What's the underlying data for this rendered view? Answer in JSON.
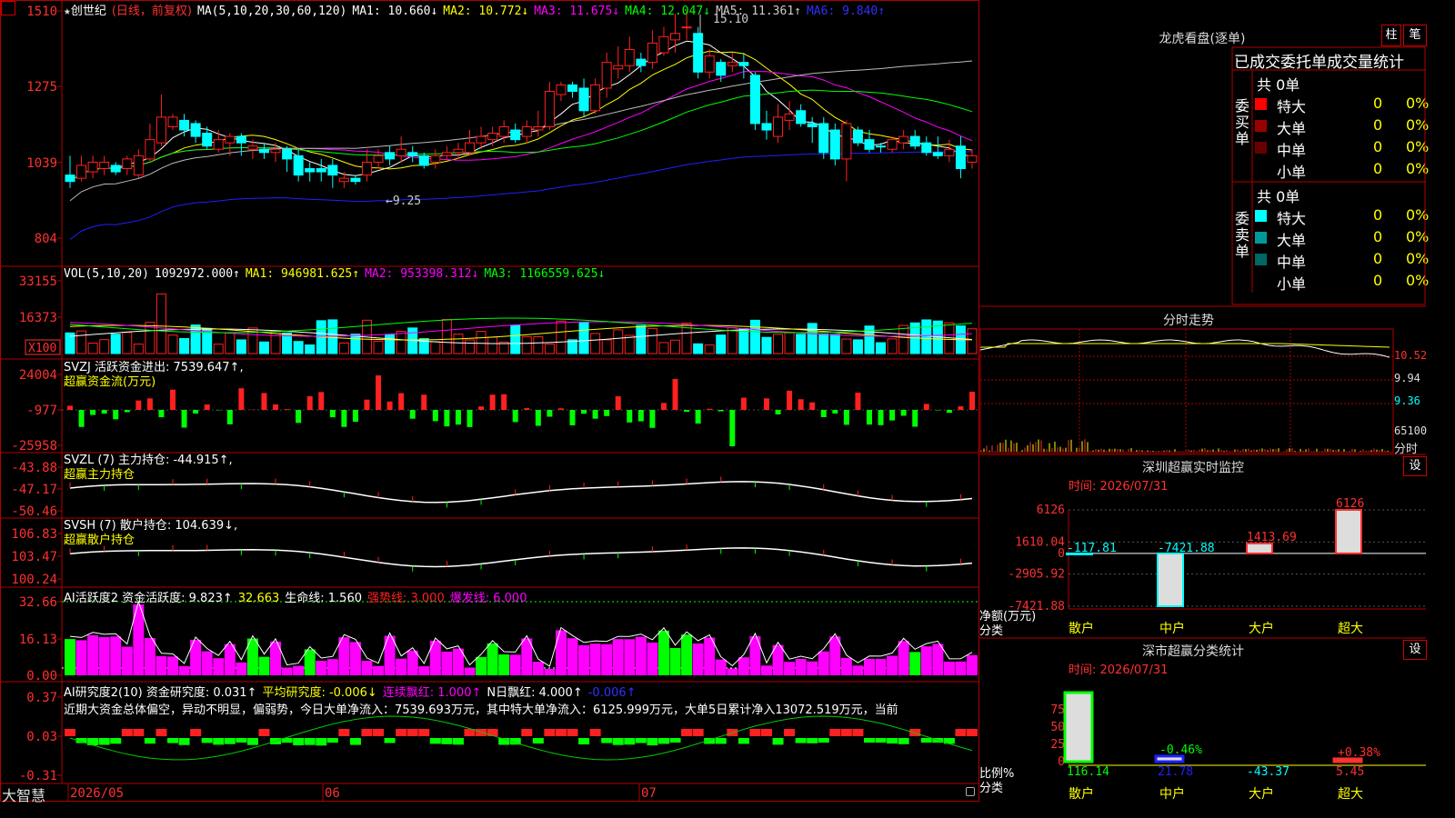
{
  "app": {
    "logo": "大智慧",
    "menu_icon": "square-menu-icon"
  },
  "colors": {
    "up": "#ff2020",
    "down": "#00ffff",
    "grid": "#b00000",
    "ma1": "#ffffff",
    "ma2": "#ffff00",
    "ma3": "#ff00ff",
    "ma4": "#00ff00",
    "ma5": "#bbbbbb",
    "ma6": "#2020ff",
    "greenbar": "#00ff00",
    "magenta": "#ff00ff"
  },
  "main": {
    "star": "★",
    "stock": "创世纪",
    "period": "(日线，前复权)",
    "ma_label": "MA(5,10,20,30,60,120)",
    "ma1": "MA1: 10.660↓",
    "ma2": "MA2: 10.772↓",
    "ma3": "MA3: 11.675↓",
    "ma4": "MA4: 12.047↓",
    "ma5": "MA5: 11.361↑",
    "ma6": "MA6: 9.840↑",
    "high_mark": "15.10",
    "low_mark": "←9.25",
    "y_labels": [
      "1510",
      "1275",
      "1039",
      "804"
    ]
  },
  "vol": {
    "title": "VOL(5,10,20)",
    "v": "1092972.000↑",
    "ma1": "MA1: 946981.625↑",
    "ma2": "MA2: 953398.312↓",
    "ma3": "MA3: 1166559.625↓",
    "y_labels": [
      "33155",
      "16373",
      "X100"
    ]
  },
  "svzj": {
    "title": "SVZJ  活跃资金进出: 7539.647↑,",
    "sub": "超赢资金流(万元)",
    "y_labels": [
      "24004",
      "-977",
      "-25958"
    ]
  },
  "svzl": {
    "title": "SVZL (7) 主力持仓: -44.915↑,",
    "sub": "超赢主力持仓",
    "y_labels": [
      "-43.88",
      "-47.17",
      "-50.46"
    ]
  },
  "svsh": {
    "title": "SVSH (7) 散户持仓: 104.639↓,",
    "sub": "超赢散户持仓",
    "y_labels": [
      "106.83",
      "103.47",
      "100.24"
    ]
  },
  "ai1": {
    "title": "AI活跃度2 资金活跃度: 9.823↑",
    "v2": "32.663",
    "v3": "生命线: 1.560",
    "v4": "强势线: 3.000",
    "v5": "爆发线: 6.000",
    "y_labels": [
      "32.66",
      "16.13",
      "0.00"
    ]
  },
  "ai2": {
    "title": "AI研究度2(10) 资金研究度: 0.031↑",
    "v2": "平均研究度: -0.006↓",
    "v3": "连续飘红: 1.000↑",
    "v4": "N日飘红: 4.000↑",
    "v5": "-0.006↑",
    "text": "近期大资金总体偏空，异动不明显，偏弱势，今日大单净流入：7539.693万元，其中特大单净流入：6125.999万元，大单5日累计净入13072.519万元，当前",
    "y_labels": [
      "0.37",
      "0.03",
      "-0.31"
    ]
  },
  "xaxis": {
    "labels": [
      "2026/05",
      "06",
      "07"
    ]
  },
  "dragon": {
    "title": "龙虎看盘(逐单)",
    "btn1": "柱",
    "btn2": "笔",
    "header": "已成交委托单成交量统计",
    "buy_label": "委买单",
    "sell_label": "委卖单",
    "buy_total": "共 0单",
    "sell_total": "共 0单",
    "buy_rows": [
      {
        "name": "特大",
        "v": "0",
        "p": "0%"
      },
      {
        "name": "大单",
        "v": "0",
        "p": "0%"
      },
      {
        "name": "中单",
        "v": "0",
        "p": "0%"
      },
      {
        "name": "小单",
        "v": "0",
        "p": "0%"
      }
    ],
    "sell_rows": [
      {
        "name": "特大",
        "v": "0",
        "p": "0%"
      },
      {
        "name": "大单",
        "v": "0",
        "p": "0%"
      },
      {
        "name": "中单",
        "v": "0",
        "p": "0%"
      },
      {
        "name": "小单",
        "v": "0",
        "p": "0%"
      }
    ]
  },
  "intraday": {
    "title": "分时走势",
    "labels": [
      "10.52",
      "9.94",
      "9.36",
      "65100",
      "分时"
    ]
  },
  "sz_monitor": {
    "title": "深圳超赢实时监控",
    "btn": "设",
    "time": "时间: 2026/07/31",
    "ylabel": "净额(万元)",
    "xlabel": "分类",
    "y_labels": [
      "6126",
      "1610.04",
      "0",
      "-2905.92",
      "-7421.88"
    ],
    "categories": [
      "散户",
      "中户",
      "大户",
      "超大"
    ]
  },
  "sz_class": {
    "title": "深市超赢分类统计",
    "btn": "设",
    "time": "时间: 2026/07/31",
    "ylabel": "比例%",
    "xlabel": "分类",
    "y_labels": [
      "75",
      "50",
      "25",
      "0"
    ],
    "categories": [
      "散户",
      "中户",
      "大户",
      "超大"
    ]
  },
  "chart_data": [
    {
      "type": "candlestick",
      "title": "创世纪 (日线，前复权)",
      "ylim": [
        804,
        1510
      ],
      "series": [
        {
          "name": "MA1",
          "last": 10.66
        },
        {
          "name": "MA2",
          "last": 10.772
        },
        {
          "name": "MA3",
          "last": 11.675
        },
        {
          "name": "MA4",
          "last": 12.047
        },
        {
          "name": "MA5",
          "last": 11.361
        },
        {
          "name": "MA6",
          "last": 9.84
        }
      ],
      "high": 15.1,
      "low": 9.25,
      "candles": [
        [
          1000,
          980,
          960,
          1060,
          "d"
        ],
        [
          990,
          1030,
          980,
          1060,
          "u"
        ],
        [
          1010,
          1040,
          990,
          1060,
          "u"
        ],
        [
          1020,
          1040,
          1000,
          1060,
          "u"
        ],
        [
          1030,
          1010,
          1000,
          1040,
          "d"
        ],
        [
          1020,
          1050,
          1000,
          1060,
          "u"
        ],
        [
          1000,
          1060,
          990,
          1080,
          "u"
        ],
        [
          1050,
          1110,
          1040,
          1160,
          "u"
        ],
        [
          1100,
          1180,
          1090,
          1250,
          "u"
        ],
        [
          1150,
          1180,
          1140,
          1190,
          "u"
        ],
        [
          1170,
          1140,
          1120,
          1190,
          "d"
        ],
        [
          1160,
          1120,
          1100,
          1170,
          "d"
        ],
        [
          1130,
          1090,
          1080,
          1150,
          "d"
        ],
        [
          1080,
          1110,
          1070,
          1140,
          "u"
        ],
        [
          1100,
          1120,
          1060,
          1130,
          "u"
        ],
        [
          1120,
          1100,
          1060,
          1130,
          "d"
        ],
        [
          1080,
          1090,
          1050,
          1110,
          "u"
        ],
        [
          1080,
          1070,
          1050,
          1100,
          "d"
        ],
        [
          1070,
          1080,
          1040,
          1100,
          "u"
        ],
        [
          1080,
          1050,
          1010,
          1090,
          "d"
        ],
        [
          1060,
          1000,
          980,
          1080,
          "d"
        ],
        [
          1020,
          1010,
          980,
          1040,
          "d"
        ],
        [
          1020,
          1010,
          980,
          1050,
          "d"
        ],
        [
          1030,
          1000,
          960,
          1050,
          "d"
        ],
        [
          980,
          990,
          960,
          1010,
          "u"
        ],
        [
          990,
          980,
          970,
          1000,
          "d"
        ],
        [
          1000,
          1040,
          980,
          1080,
          "u"
        ],
        [
          1040,
          1060,
          1020,
          1080,
          "u"
        ],
        [
          1070,
          1050,
          1030,
          1090,
          "d"
        ],
        [
          1060,
          1080,
          1040,
          1120,
          "u"
        ],
        [
          1060,
          1070,
          1040,
          1090,
          "d"
        ],
        [
          1060,
          1030,
          1020,
          1070,
          "d"
        ],
        [
          1040,
          1060,
          1020,
          1080,
          "u"
        ],
        [
          1060,
          1070,
          1050,
          1090,
          "u"
        ],
        [
          1070,
          1080,
          1050,
          1100,
          "u"
        ],
        [
          1070,
          1100,
          1060,
          1140,
          "u"
        ],
        [
          1100,
          1120,
          1080,
          1150,
          "u"
        ],
        [
          1110,
          1130,
          1090,
          1150,
          "u"
        ],
        [
          1120,
          1150,
          1100,
          1170,
          "u"
        ],
        [
          1140,
          1110,
          1100,
          1160,
          "d"
        ],
        [
          1120,
          1150,
          1100,
          1170,
          "u"
        ],
        [
          1140,
          1150,
          1120,
          1200,
          "u"
        ],
        [
          1150,
          1260,
          1140,
          1290,
          "u"
        ],
        [
          1250,
          1280,
          1230,
          1290,
          "u"
        ],
        [
          1280,
          1260,
          1240,
          1290,
          "d"
        ],
        [
          1270,
          1200,
          1180,
          1300,
          "d"
        ],
        [
          1200,
          1280,
          1190,
          1300,
          "u"
        ],
        [
          1270,
          1350,
          1240,
          1380,
          "u"
        ],
        [
          1330,
          1340,
          1300,
          1400,
          "u"
        ],
        [
          1340,
          1390,
          1320,
          1430,
          "u"
        ],
        [
          1360,
          1340,
          1320,
          1380,
          "d"
        ],
        [
          1350,
          1410,
          1330,
          1450,
          "u"
        ],
        [
          1380,
          1430,
          1370,
          1460,
          "u"
        ],
        [
          1420,
          1440,
          1380,
          1500,
          "u"
        ],
        [
          1460,
          1460,
          1420,
          1510,
          "u"
        ],
        [
          1440,
          1320,
          1300,
          1460,
          "d"
        ],
        [
          1320,
          1370,
          1300,
          1390,
          "u"
        ],
        [
          1350,
          1310,
          1290,
          1360,
          "d"
        ],
        [
          1340,
          1350,
          1320,
          1380,
          "u"
        ],
        [
          1350,
          1340,
          1300,
          1380,
          "d"
        ],
        [
          1310,
          1160,
          1140,
          1320,
          "d"
        ],
        [
          1160,
          1140,
          1110,
          1200,
          "d"
        ],
        [
          1120,
          1180,
          1100,
          1220,
          "u"
        ],
        [
          1170,
          1190,
          1140,
          1230,
          "u"
        ],
        [
          1200,
          1160,
          1150,
          1220,
          "d"
        ],
        [
          1160,
          1150,
          1100,
          1180,
          "d"
        ],
        [
          1160,
          1070,
          1050,
          1180,
          "d"
        ],
        [
          1140,
          1050,
          1030,
          1160,
          "d"
        ],
        [
          1050,
          1160,
          980,
          1170,
          "u"
        ],
        [
          1140,
          1100,
          1090,
          1150,
          "d"
        ],
        [
          1110,
          1080,
          1070,
          1140,
          "d"
        ],
        [
          1090,
          1090,
          1070,
          1100,
          "d"
        ],
        [
          1080,
          1110,
          1070,
          1120,
          "u"
        ],
        [
          1100,
          1120,
          1080,
          1140,
          "u"
        ],
        [
          1120,
          1090,
          1080,
          1140,
          "d"
        ],
        [
          1100,
          1070,
          1060,
          1120,
          "d"
        ],
        [
          1070,
          1060,
          1050,
          1120,
          "d"
        ],
        [
          1060,
          1080,
          1040,
          1110,
          "u"
        ],
        [
          1090,
          1020,
          990,
          1120,
          "d"
        ],
        [
          1040,
          1060,
          1020,
          1080,
          "u"
        ]
      ]
    },
    {
      "type": "bar",
      "title": "VOL(5,10,20)",
      "ylim": [
        0,
        33155
      ]
    },
    {
      "type": "bar",
      "title": "超赢资金流(万元)",
      "ylim": [
        -25958,
        24004
      ]
    },
    {
      "type": "line",
      "title": "超赢主力持仓",
      "ylim": [
        -50.46,
        -43.88
      ]
    },
    {
      "type": "line",
      "title": "超赢散户持仓",
      "ylim": [
        100.24,
        106.83
      ]
    },
    {
      "type": "bar",
      "title": "AI活跃度2",
      "ylim": [
        0,
        32.66
      ]
    },
    {
      "type": "bar",
      "title": "AI研究度2(10)",
      "ylim": [
        -0.31,
        0.37
      ]
    },
    {
      "type": "bar",
      "title": "深圳超赢实时监控",
      "categories": [
        "散户",
        "中户",
        "大户",
        "超大"
      ],
      "values": [
        -117.81,
        -7421.88,
        1413.69,
        6126
      ],
      "ylim": [
        -7421.88,
        6126
      ]
    },
    {
      "type": "bar",
      "title": "深市超赢分类统计",
      "categories": [
        "散户",
        "中户",
        "大户",
        "超大"
      ],
      "values": [
        116.14,
        21.78,
        -43.37,
        5.45
      ],
      "bar_labels": [
        "",
        "-0.46%",
        "",
        "+0.38%"
      ],
      "ylim": [
        0,
        75
      ]
    }
  ]
}
